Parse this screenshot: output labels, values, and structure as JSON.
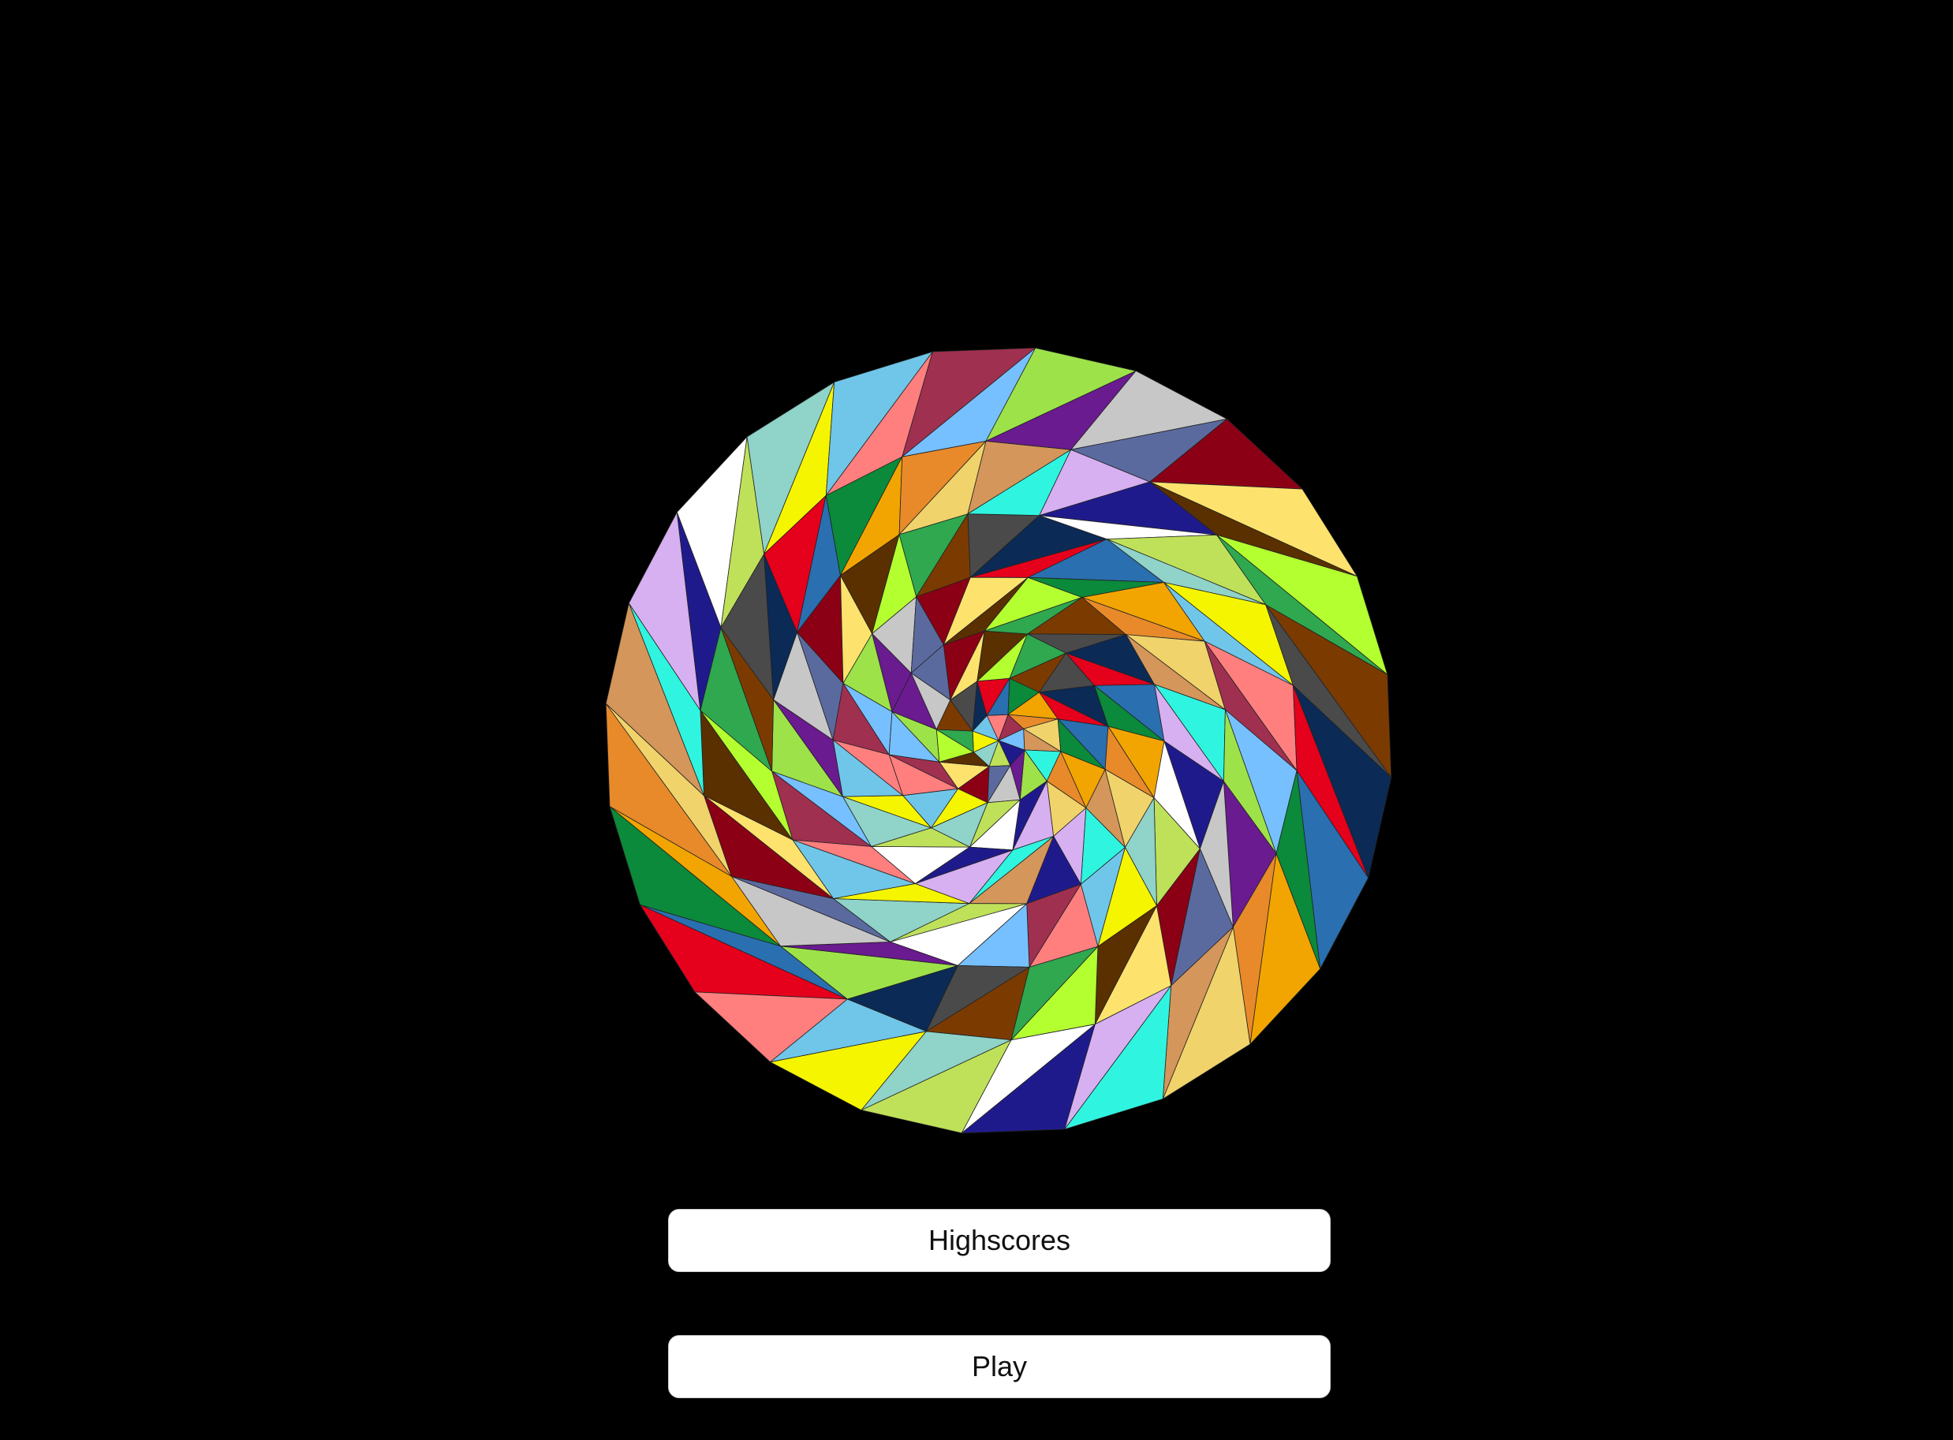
{
  "background_color": "#000000",
  "logo": {
    "icon": "faceted-triangle-sphere-icon",
    "palette": [
      "#e5001c",
      "#f5f500",
      "#2fa84f",
      "#1f1a8c",
      "#8b0015",
      "#f0d36a",
      "#9ee24a",
      "#2a6fb0",
      "#70c6e8",
      "#7b3b00",
      "#ffffff",
      "#fde36d",
      "#d4965a",
      "#6a1b8f",
      "#0a8a3a",
      "#ff7f7f",
      "#4a4a4a",
      "#bfe15a",
      "#5a3000",
      "#2ff5e0",
      "#c7c7c7",
      "#f2a500",
      "#a03050",
      "#0b2a55",
      "#8fd3c9",
      "#b4ff2f",
      "#d6b0f0",
      "#5b6a9e",
      "#e88a2a",
      "#76c0ff"
    ]
  },
  "menu": {
    "highscores_label": "Highscores",
    "play_label": "Play"
  }
}
